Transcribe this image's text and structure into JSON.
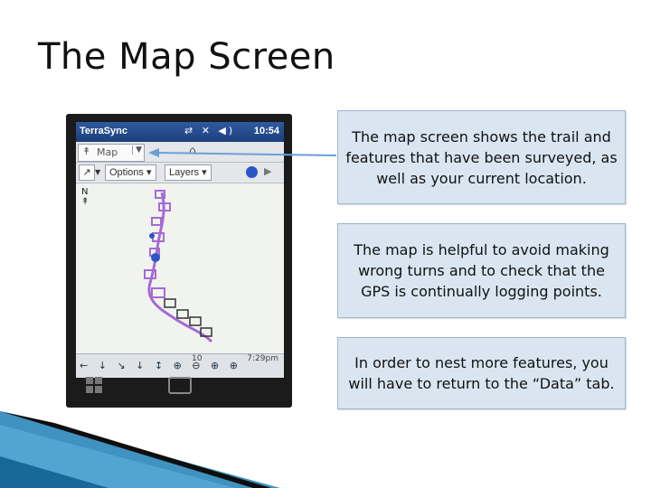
{
  "slide": {
    "title": "The Map Screen"
  },
  "device": {
    "statusbar": {
      "app_name": "TerraSync",
      "clock": "10:54"
    },
    "toolbar1": {
      "section": "Map"
    },
    "toolbar2": {
      "options_label": "Options",
      "layers_label": "Layers"
    },
    "bottombar": {
      "scale": "10",
      "time": "7:29pm"
    }
  },
  "callouts": [
    "The map screen shows the trail and features that have been surveyed, as well as your current location.",
    "The map is helpful to avoid making wrong turns and to check that the GPS is continually logging points.",
    "In order to nest more features, you will have to return to the “Data” tab."
  ],
  "colors": {
    "callout_fill": "#d9e6f2",
    "callout_border": "#9fb5cc",
    "track_purple": "#a56ad6",
    "track_blue": "#2a55c8",
    "decor_blue": "#1f7fb6"
  },
  "icons": [
    "north-arrow-icon",
    "gps-receiver-icon",
    "windows-start-icon",
    "keyboard-icon",
    "speaker-icon",
    "connectivity-icon"
  ]
}
